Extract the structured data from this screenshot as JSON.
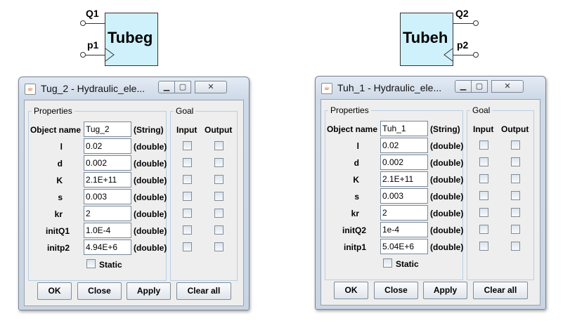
{
  "blocks": [
    {
      "name": "Tubeg",
      "top_port": "Q1",
      "bottom_port": "p1"
    },
    {
      "name": "Tubeh",
      "top_port": "Q2",
      "bottom_port": "p2"
    }
  ],
  "dialogs": [
    {
      "title": "Tug_2 - Hydraulic_ele...",
      "properties_legend": "Properties",
      "goal_legend": "Goal",
      "col_input": "Input",
      "col_output": "Output",
      "object_name_label": "Object name",
      "object_name_value": "Tug_2",
      "object_name_type": "(String)",
      "params": [
        {
          "label": "l",
          "value": "0.02",
          "type": "(double)"
        },
        {
          "label": "d",
          "value": "0.002",
          "type": "(double)"
        },
        {
          "label": "K",
          "value": "2.1E+11",
          "type": "(double)"
        },
        {
          "label": "s",
          "value": "0.003",
          "type": "(double)"
        },
        {
          "label": "kr",
          "value": "2",
          "type": "(double)"
        },
        {
          "label": "initQ1",
          "value": "1.0E-4",
          "type": "(double)"
        },
        {
          "label": "initp2",
          "value": "4.94E+6",
          "type": "(double)"
        }
      ],
      "static_label": "Static",
      "buttons": {
        "ok": "OK",
        "close": "Close",
        "apply": "Apply",
        "clear": "Clear all"
      }
    },
    {
      "title": "Tuh_1 - Hydraulic_ele...",
      "properties_legend": "Properties",
      "goal_legend": "Goal",
      "col_input": "Input",
      "col_output": "Output",
      "object_name_label": "Object name",
      "object_name_value": "Tuh_1",
      "object_name_type": "(String)",
      "params": [
        {
          "label": "l",
          "value": "0.02",
          "type": "(double)"
        },
        {
          "label": "d",
          "value": "0.002",
          "type": "(double)"
        },
        {
          "label": "K",
          "value": "2.1E+11",
          "type": "(double)"
        },
        {
          "label": "s",
          "value": "0.003",
          "type": "(double)"
        },
        {
          "label": "kr",
          "value": "2",
          "type": "(double)"
        },
        {
          "label": "initQ2",
          "value": "1e-4",
          "type": "(double)"
        },
        {
          "label": "initp1",
          "value": "5.04E+6",
          "type": "(double)"
        }
      ],
      "static_label": "Static",
      "buttons": {
        "ok": "OK",
        "close": "Close",
        "apply": "Apply",
        "clear": "Clear all"
      }
    }
  ]
}
